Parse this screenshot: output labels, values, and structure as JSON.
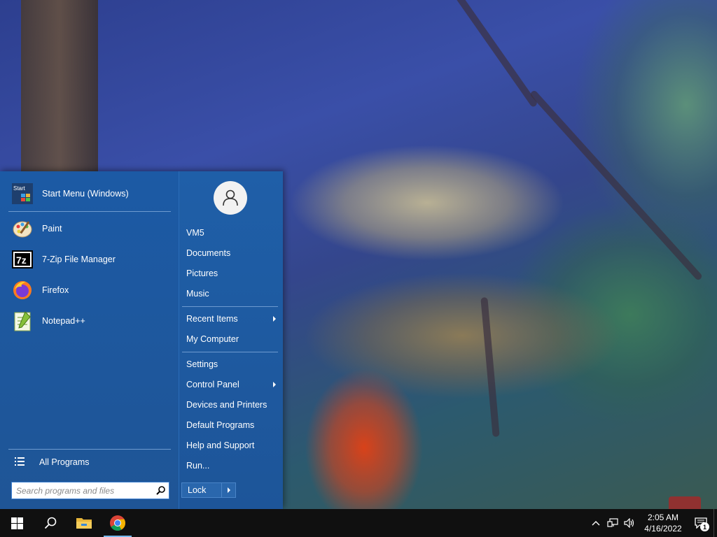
{
  "start_menu": {
    "pinned_header": {
      "icon_text": "Start",
      "label": "Start Menu (Windows)"
    },
    "apps": [
      {
        "label": "Paint",
        "icon": "paint-icon"
      },
      {
        "label": "7-Zip File Manager",
        "icon": "7zip-icon",
        "icon_text": "7z"
      },
      {
        "label": "Firefox",
        "icon": "firefox-icon"
      },
      {
        "label": "Notepad++",
        "icon": "notepadpp-icon"
      }
    ],
    "all_programs_label": "All Programs",
    "search": {
      "placeholder": "Search programs and files",
      "value": ""
    },
    "right": {
      "user": "VM5",
      "items": [
        {
          "label": "Documents"
        },
        {
          "label": "Pictures"
        },
        {
          "label": "Music"
        },
        {
          "label": "Recent Items"
        },
        {
          "label": "My Computer"
        },
        {
          "label": "Settings"
        },
        {
          "label": "Control Panel"
        },
        {
          "label": "Devices and Printers"
        },
        {
          "label": "Default Programs"
        },
        {
          "label": "Help and Support"
        },
        {
          "label": "Run..."
        }
      ],
      "lock_label": "Lock"
    }
  },
  "taskbar": {
    "buttons": [
      "windows-start-icon",
      "search-icon",
      "file-explorer-icon",
      "chrome-icon"
    ],
    "clock": {
      "time": "2:05 AM",
      "date": "4/16/2022"
    },
    "notification_count": "1"
  },
  "colors": {
    "menu_blue": "#1c5aa5",
    "taskbar": "#101010",
    "accent": "#76b9ed"
  }
}
